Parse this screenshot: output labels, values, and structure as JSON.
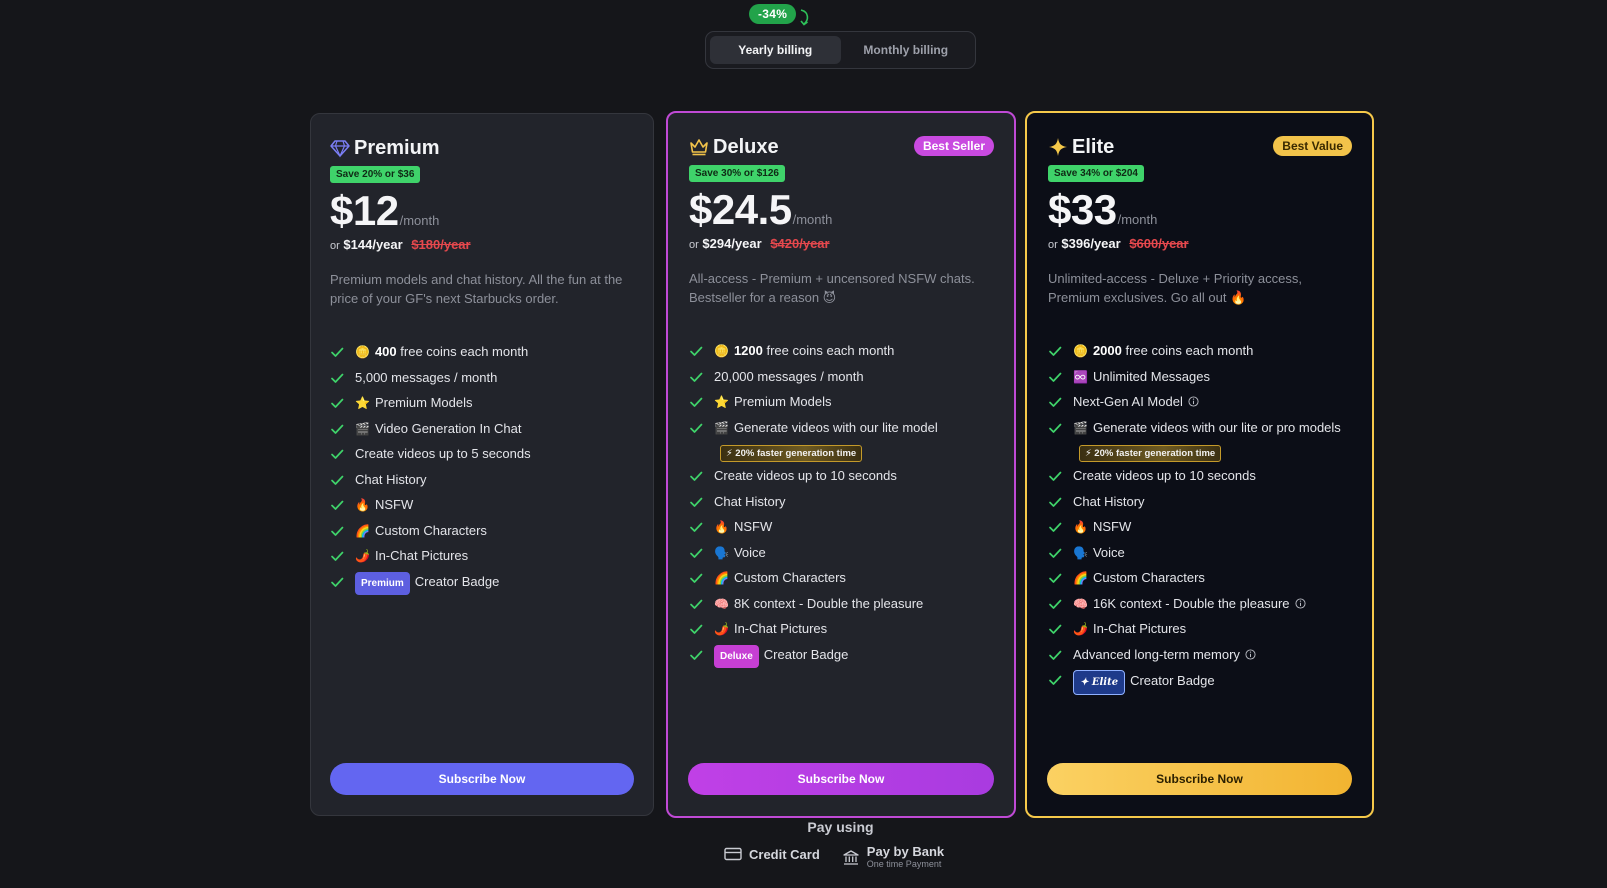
{
  "billing": {
    "discount": "-34%",
    "yearly_label": "Yearly billing",
    "monthly_label": "Monthly billing"
  },
  "plans": [
    {
      "name": "Premium",
      "icon": "diamond-icon",
      "badge": "",
      "save": "Save 20% or $36",
      "price": "$12",
      "per": "/month",
      "or": "or",
      "yearly": "$144/year",
      "old_yearly": "$180/year",
      "description": "Premium models and chat history. All the fun at the price of your GF's next Starbucks order.",
      "features": [
        {
          "emoji": "🪙",
          "strong": "400",
          "text": " free coins each month"
        },
        {
          "emoji": "",
          "strong": "",
          "text": "5,000 messages / month"
        },
        {
          "emoji": "⭐",
          "strong": "",
          "text": "Premium Models"
        },
        {
          "emoji": "🎬",
          "strong": "",
          "text": "Video Generation In Chat"
        },
        {
          "emoji": "",
          "strong": "",
          "text": "Create videos up to 5 seconds"
        },
        {
          "emoji": "",
          "strong": "",
          "text": "Chat History"
        },
        {
          "emoji": "🔥",
          "strong": "",
          "text": "NSFW"
        },
        {
          "emoji": "🌈",
          "strong": "",
          "text": "Custom Characters"
        },
        {
          "emoji": "🌶️",
          "strong": "",
          "text": "In-Chat Pictures"
        },
        {
          "emoji": "",
          "strong": "",
          "text": "Creator Badge",
          "badge": "Premium"
        }
      ],
      "cta": "Subscribe Now"
    },
    {
      "name": "Deluxe",
      "icon": "crown-icon",
      "badge": "Best Seller",
      "save": "Save 30% or $126",
      "price": "$24.5",
      "per": "/month",
      "or": "or",
      "yearly": "$294/year",
      "old_yearly": "$420/year",
      "description": "All-access - Premium + uncensored NSFW chats. Bestseller for a reason 😈",
      "features": [
        {
          "emoji": "🪙",
          "strong": "1200",
          "text": " free coins each month"
        },
        {
          "emoji": "",
          "strong": "",
          "text": "20,000 messages / month"
        },
        {
          "emoji": "⭐",
          "strong": "",
          "text": "Premium Models"
        },
        {
          "emoji": "🎬",
          "strong": "",
          "text": "Generate videos with our lite model",
          "faster": "⚡ 20% faster generation time"
        },
        {
          "emoji": "",
          "strong": "",
          "text": "Create videos up to 10 seconds"
        },
        {
          "emoji": "",
          "strong": "",
          "text": "Chat History"
        },
        {
          "emoji": "🔥",
          "strong": "",
          "text": "NSFW"
        },
        {
          "emoji": "🗣️",
          "strong": "",
          "text": "Voice"
        },
        {
          "emoji": "🌈",
          "strong": "",
          "text": "Custom Characters"
        },
        {
          "emoji": "🧠",
          "strong": "",
          "text": "8K context - Double the pleasure"
        },
        {
          "emoji": "🌶️",
          "strong": "",
          "text": "In-Chat Pictures"
        },
        {
          "emoji": "",
          "strong": "",
          "text": "Creator Badge",
          "badge": "Deluxe"
        }
      ],
      "cta": "Subscribe Now"
    },
    {
      "name": "Elite",
      "icon": "sparkle-icon",
      "badge": "Best Value",
      "save": "Save 34% or $204",
      "price": "$33",
      "per": "/month",
      "or": "or",
      "yearly": "$396/year",
      "old_yearly": "$600/year",
      "description": "Unlimited-access - Deluxe + Priority access, Premium exclusives. Go all out 🔥",
      "features": [
        {
          "emoji": "🪙",
          "strong": "2000",
          "text": " free coins each month"
        },
        {
          "emoji": "♾️",
          "strong": "",
          "text": "Unlimited Messages"
        },
        {
          "emoji": "",
          "strong": "",
          "text": "Next-Gen AI Model",
          "info": true
        },
        {
          "emoji": "🎬",
          "strong": "",
          "text": "Generate videos with our lite or pro models",
          "faster": "⚡ 20% faster generation time"
        },
        {
          "emoji": "",
          "strong": "",
          "text": "Create videos up to 10 seconds"
        },
        {
          "emoji": "",
          "strong": "",
          "text": "Chat History"
        },
        {
          "emoji": "🔥",
          "strong": "",
          "text": "NSFW"
        },
        {
          "emoji": "🗣️",
          "strong": "",
          "text": "Voice"
        },
        {
          "emoji": "🌈",
          "strong": "",
          "text": "Custom Characters"
        },
        {
          "emoji": "🧠",
          "strong": "",
          "text": "16K context - Double the pleasure",
          "info": true
        },
        {
          "emoji": "🌶️",
          "strong": "",
          "text": "In-Chat Pictures"
        },
        {
          "emoji": "",
          "strong": "",
          "text": "Advanced long-term memory",
          "info": true
        },
        {
          "emoji": "",
          "strong": "",
          "text": "Creator Badge",
          "badge": "✦ Elite"
        }
      ],
      "cta": "Subscribe Now"
    }
  ],
  "payment": {
    "title": "Pay using",
    "credit_card": "Credit Card",
    "bank": "Pay by Bank",
    "bank_sub": "One time Payment"
  },
  "colors": {
    "premium_accent": "#6366f1",
    "deluxe_accent": "#c94ae0",
    "elite_accent": "#f6c94a",
    "check_green": "#3fd36a"
  }
}
